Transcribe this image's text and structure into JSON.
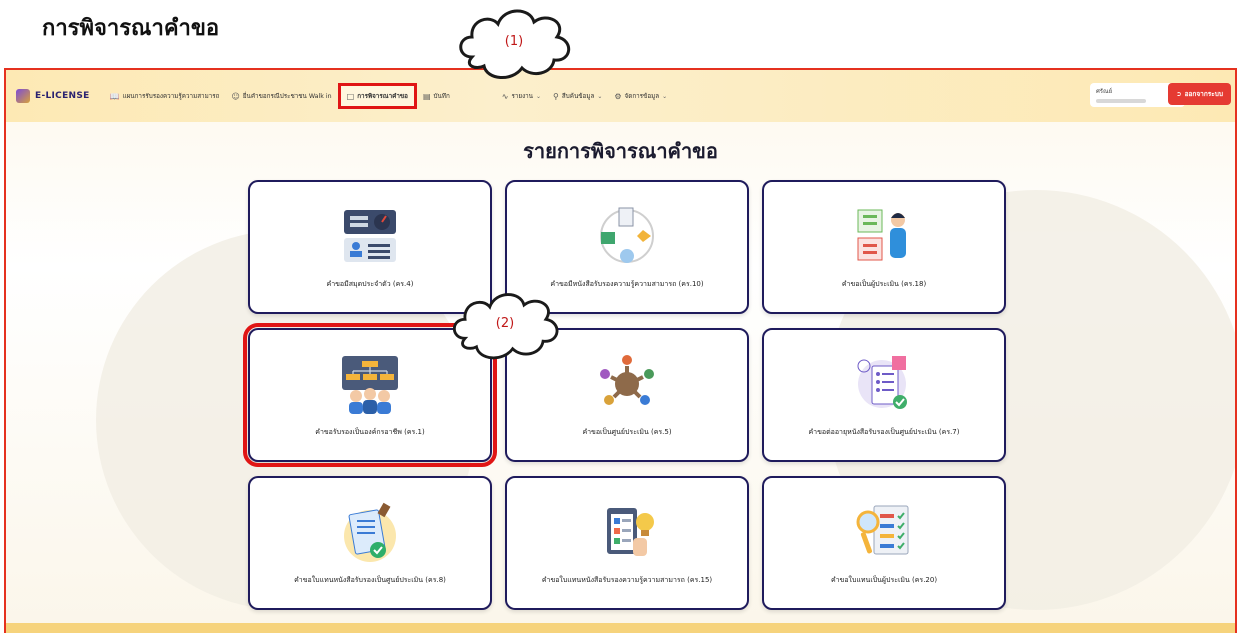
{
  "document": {
    "heading": "การพิจารณาคำขอ"
  },
  "navbar": {
    "brand": "E-LICENSE",
    "menu": [
      {
        "label": "แผนการรับรองความรู้ความสามารถ",
        "icon": "book-icon"
      },
      {
        "label": "ยื่นคำขอกรณีประชาชน Walk in",
        "icon": "user-add-icon"
      },
      {
        "label": "การพิจารณาคำขอ",
        "icon": "clipboard-icon"
      },
      {
        "label": "บันทึก",
        "icon": "document-icon"
      },
      {
        "label": "รายงาน",
        "icon": "chart-line-icon"
      },
      {
        "label": "สืบค้นข้อมูล",
        "icon": "search-icon"
      },
      {
        "label": "จัดการข้อมูล",
        "icon": "gear-icon"
      }
    ],
    "user_label": "ศรัณย์",
    "logout_label": "ออกจากระบบ"
  },
  "page": {
    "title": "รายการพิจารณาคำขอ"
  },
  "cards": [
    {
      "label": "คำขอมีสมุดประจำตัว (คร.4)",
      "icon": "id-card-icon"
    },
    {
      "label": "คำขอมีหนังสือรับรองความรู้ความสามารถ (คร.10)",
      "icon": "certificate-process-icon"
    },
    {
      "label": "คำขอเป็นผู้ประเมิน (คร.18)",
      "icon": "assessor-icon"
    },
    {
      "label": "คำขอรับรองเป็นองค์กรอาชีพ (คร.1)",
      "icon": "organization-icon"
    },
    {
      "label": "คำขอเป็นศูนย์ประเมิน (คร.5)",
      "icon": "team-circle-icon"
    },
    {
      "label": "คำขอต่ออายุหนังสือรับรองเป็นศูนย์ประเมิน (คร.7)",
      "icon": "checklist-renew-icon"
    },
    {
      "label": "คำขอใบแทนหนังสือรับรองเป็นศูนย์ประเมิน (คร.8)",
      "icon": "stamped-document-icon"
    },
    {
      "label": "คำขอใบแทนหนังสือรับรองความรู้ความสามารถ (คร.15)",
      "icon": "clipboard-idea-icon"
    },
    {
      "label": "คำขอใบแทนเป็นผู้ประเมิน (คร.20)",
      "icon": "magnifier-list-icon"
    }
  ],
  "callouts": [
    {
      "text": "(1)"
    },
    {
      "text": "(2)"
    }
  ]
}
